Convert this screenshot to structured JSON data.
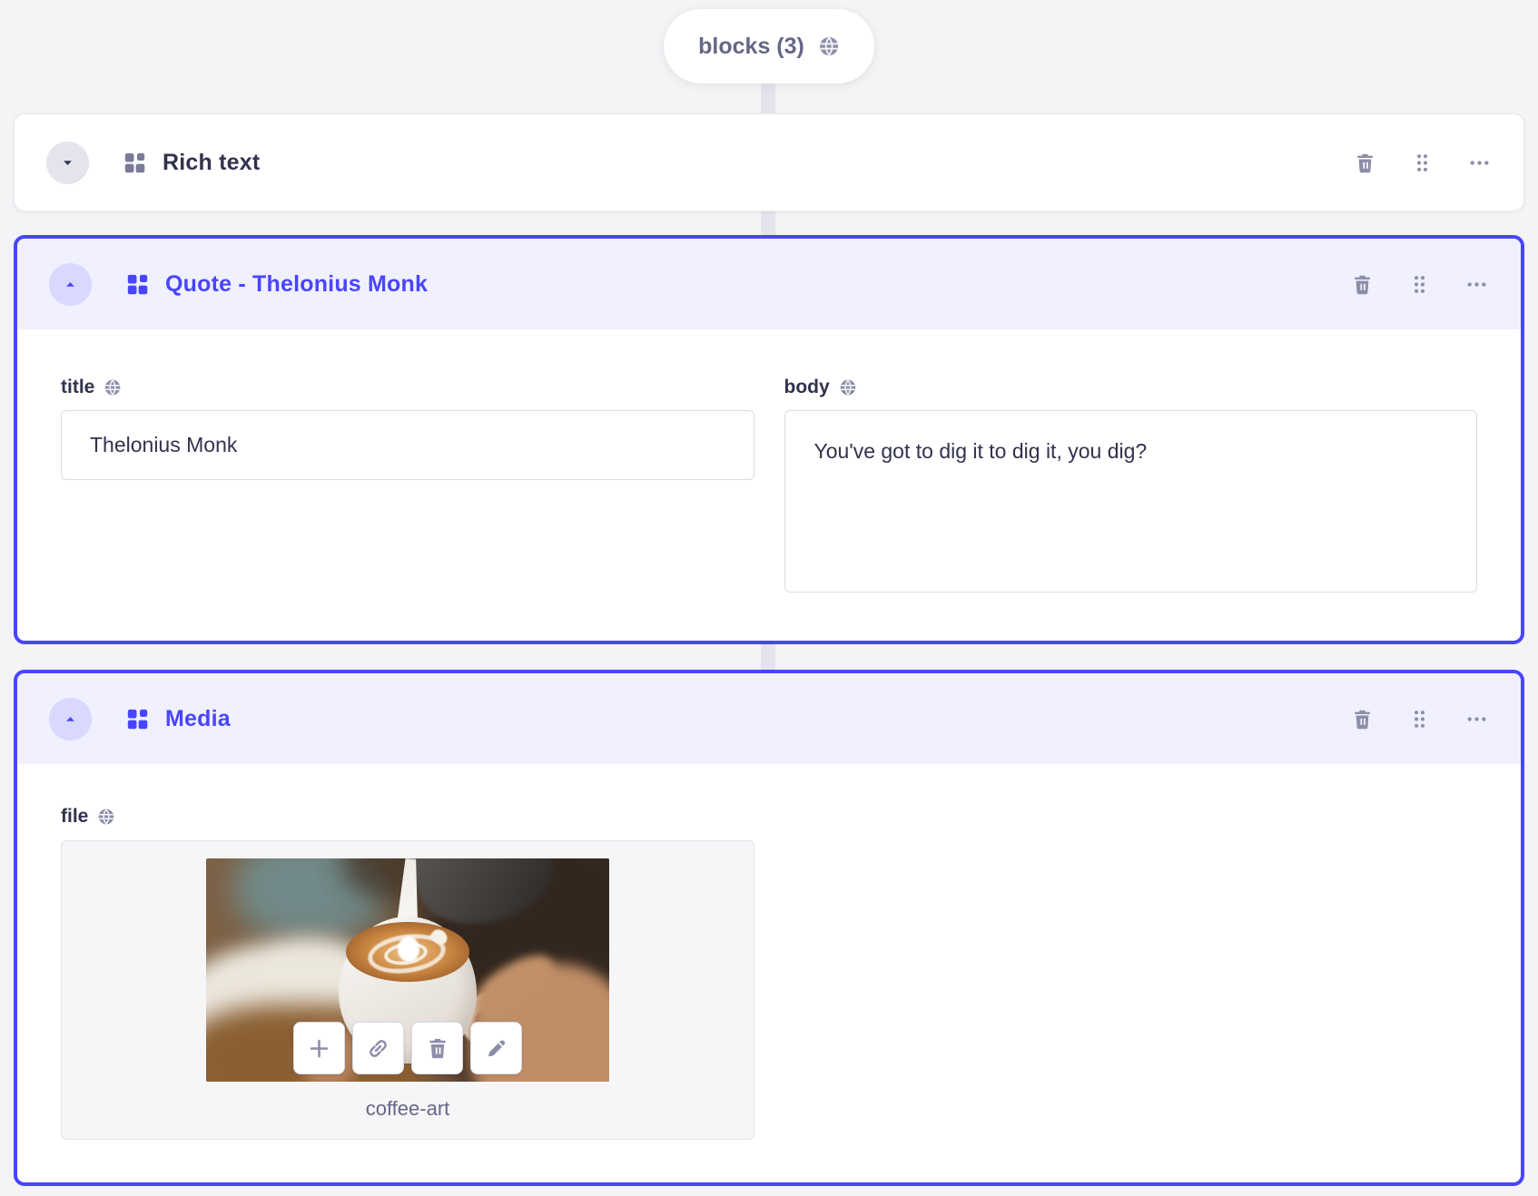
{
  "colors": {
    "accent": "#4945ff",
    "accent_header_bg": "#f0f0ff",
    "accent_circle_bg": "#d9d8ff",
    "page_bg": "#f4f4f6",
    "icon_gray": "#8e8ea9",
    "text_dark": "#32324d",
    "text_muted": "#666687"
  },
  "pill": {
    "label": "blocks (3)",
    "icon": "globe-icon"
  },
  "blocks": [
    {
      "title": "Rich text",
      "state": "collapsed",
      "toggle_icon": "caret-down-icon",
      "type_icon": "blocks-grid-icon",
      "actions": [
        "trash-icon",
        "drag-handle-icon",
        "more-options-icon"
      ]
    },
    {
      "title": "Quote - Thelonius Monk",
      "state": "expanded",
      "toggle_icon": "caret-up-icon",
      "type_icon": "blocks-grid-icon",
      "actions": [
        "trash-icon",
        "drag-handle-icon",
        "more-options-icon"
      ],
      "fields": [
        {
          "label": "title",
          "localized_icon": "globe-icon",
          "value": "Thelonius Monk"
        },
        {
          "label": "body",
          "localized_icon": "globe-icon",
          "value": "You've got to dig it to dig it, you dig?"
        }
      ]
    },
    {
      "title": "Media",
      "state": "expanded",
      "toggle_icon": "caret-up-icon",
      "type_icon": "blocks-grid-icon",
      "actions": [
        "trash-icon",
        "drag-handle-icon",
        "more-options-icon"
      ],
      "fields": [
        {
          "label": "file",
          "localized_icon": "globe-icon",
          "media": {
            "caption": "coffee-art",
            "toolbar": [
              "add-icon",
              "link-icon",
              "trash-icon",
              "edit-icon"
            ]
          }
        }
      ]
    }
  ]
}
